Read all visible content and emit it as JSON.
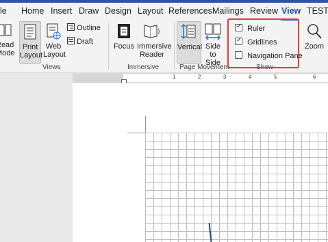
{
  "tabs": [
    "le",
    "Home",
    "Insert",
    "Draw",
    "Design",
    "Layout",
    "References",
    "Mailings",
    "Review",
    "View",
    "TEST"
  ],
  "active_tab": "View",
  "views": {
    "read_mode": [
      "Read",
      "Mode"
    ],
    "print_layout": [
      "Print",
      "Layout"
    ],
    "web_layout": [
      "Web",
      "Layout"
    ],
    "outline": "Outline",
    "draft": "Draft",
    "group_label": "Views"
  },
  "immersive": {
    "focus": "Focus",
    "immersive_reader": [
      "Immersive",
      "Reader"
    ],
    "group_label": "Immersive"
  },
  "page_movement": {
    "vertical": "Vertical",
    "side_to_side": [
      "Side",
      "to Side"
    ],
    "group_label": "Page Movement"
  },
  "show": {
    "ruler": {
      "label": "Ruler",
      "checked": true
    },
    "gridlines": {
      "label": "Gridlines",
      "checked": true
    },
    "navigation_pane": {
      "label": "Navigation Pane",
      "checked": false
    },
    "group_label": "Show"
  },
  "zoom": "Zoom",
  "ruler_marks": [
    "1",
    "2",
    "3",
    "4",
    "5",
    "6"
  ],
  "colors": {
    "accent": "#1e4e9c",
    "highlight": "#e23b3b",
    "titlebar": "#2b579a"
  }
}
